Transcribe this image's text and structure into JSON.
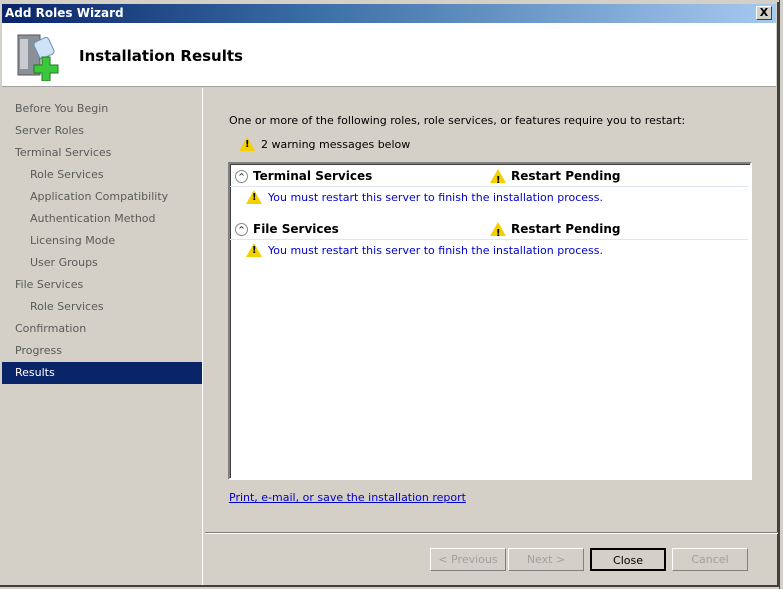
{
  "window": {
    "title": "Add Roles Wizard",
    "close": "X"
  },
  "header": {
    "title": "Installation Results"
  },
  "nav": [
    {
      "label": "Before You Begin",
      "sub": false
    },
    {
      "label": "Server Roles",
      "sub": false
    },
    {
      "label": "Terminal Services",
      "sub": false
    },
    {
      "label": "Role Services",
      "sub": true
    },
    {
      "label": "Application Compatibility",
      "sub": true
    },
    {
      "label": "Authentication Method",
      "sub": true
    },
    {
      "label": "Licensing Mode",
      "sub": true
    },
    {
      "label": "User Groups",
      "sub": true
    },
    {
      "label": "File Services",
      "sub": false
    },
    {
      "label": "Role Services",
      "sub": true
    },
    {
      "label": "Confirmation",
      "sub": false
    },
    {
      "label": "Progress",
      "sub": false
    },
    {
      "label": "Results",
      "sub": false,
      "active": true
    }
  ],
  "main": {
    "intro": "One or more of the following roles, role services, or features require you to restart:",
    "warning_count": "2 warning messages below",
    "results": [
      {
        "name": "Terminal Services",
        "status": "Restart Pending",
        "message": "You must restart this server to finish the installation process."
      },
      {
        "name": "File Services",
        "status": "Restart Pending",
        "message": "You must restart this server to finish the installation process."
      }
    ],
    "report_link": "Print, e-mail, or save the installation report"
  },
  "buttons": {
    "previous": "< Previous",
    "next": "Next >",
    "close": "Close",
    "cancel": "Cancel"
  }
}
